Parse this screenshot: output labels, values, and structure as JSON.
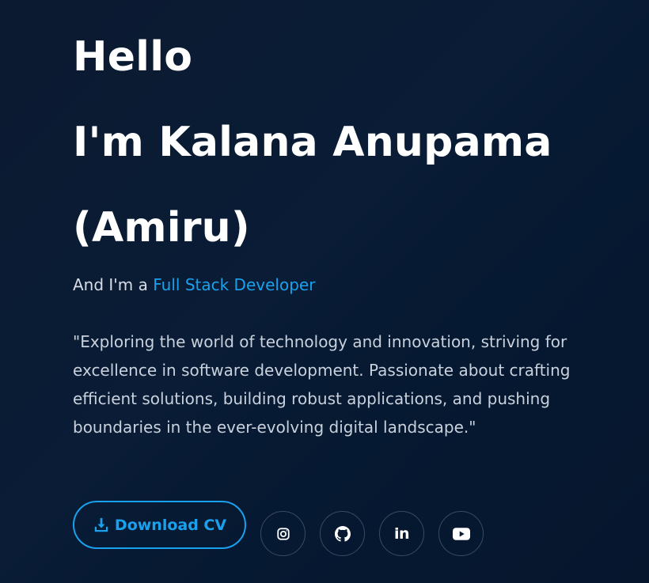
{
  "hero": {
    "greeting": "Hello",
    "name_line": "I'm Kalana Anupama",
    "nickname_line": "(Amiru)",
    "role_prefix": "And I'm a ",
    "role_highlight": "Full Stack Developer",
    "bio": "\"Exploring the world of technology and innovation, striving for excellence in software development. Passionate about crafting efficient solutions, building robust applications, and pushing boundaries in the ever-evolving digital landscape.\""
  },
  "actions": {
    "download_label": "Download CV",
    "download_icon": "download-icon"
  },
  "socials": [
    {
      "name": "instagram",
      "icon": "instagram-icon"
    },
    {
      "name": "github",
      "icon": "github-icon"
    },
    {
      "name": "linkedin",
      "icon": "linkedin-icon",
      "text": "in"
    },
    {
      "name": "youtube",
      "icon": "youtube-icon"
    }
  ],
  "colors": {
    "accent": "#1aa1ee",
    "background": "#0a1c36",
    "text": "#ffffff",
    "muted_text": "#c9d1dc"
  }
}
